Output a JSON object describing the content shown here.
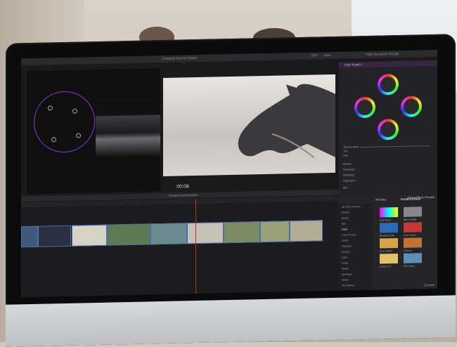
{
  "app": {
    "project_title": "Creative Summit Mare",
    "topbar_right": "High Dynamic Range",
    "zoom": "25%",
    "view_label": "View",
    "timecode": "00:08",
    "timeline_name": "Creative Summit Demo",
    "effects_button": "Show Effects Presets"
  },
  "inspector": {
    "effect_name": "Color Board 1",
    "wheels": [
      "MASTER",
      "SHADOWS",
      "HIGHLIGHTS",
      "MIDTONES"
    ],
    "params": [
      "Temperature",
      "Tint",
      "Hue",
      "Mix"
    ],
    "sections": [
      "Master",
      "Shadows",
      "Midtones",
      "Highlights"
    ]
  },
  "effects": {
    "tab_all": "All Video",
    "tab_installed": "Installed Effects",
    "categories": [
      "All Video & Audio",
      "VIDEO",
      "Basics",
      "Blur",
      "Color",
      "Color Presets",
      "Comic",
      "Distortion",
      "Keying",
      "Light",
      "Looks",
      "Masks",
      "Nostalgia",
      "Stylize",
      "Text Effects",
      "Tiling"
    ],
    "items": [
      "Color Board",
      "Black & White",
      "Broadcast Safe",
      "Color Curves",
      "Color Wheels",
      "Colorize",
      "Custom LUT",
      "HSV Tones"
    ],
    "count": "12 Items"
  },
  "colors": {
    "accent": "#7e3bd0",
    "clip_border": "#4a6fb0",
    "playhead": "#c9252b"
  }
}
